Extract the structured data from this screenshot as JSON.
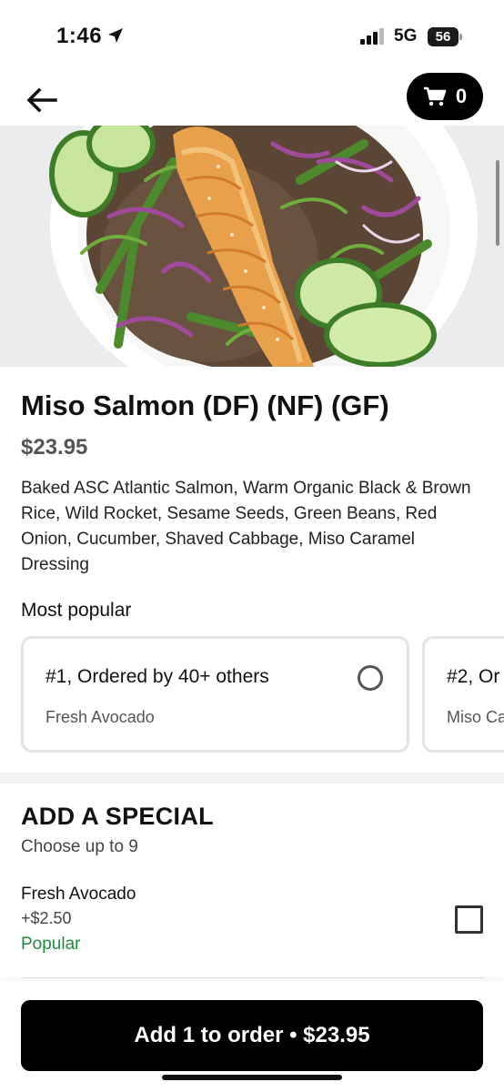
{
  "status_bar": {
    "time": "1:46",
    "network": "5G",
    "battery": "56"
  },
  "header": {
    "cart_count": "0"
  },
  "item": {
    "title": "Miso Salmon (DF) (NF) (GF)",
    "price": "$23.95",
    "description": "Baked ASC Atlantic Salmon, Warm Organic Black & Brown Rice, Wild Rocket, Sesame Seeds, Green Beans, Red Onion, Cucumber, Shaved Cabbage, Miso Caramel Dressing"
  },
  "most_popular": {
    "label": "Most popular",
    "cards": [
      {
        "title": "#1, Ordered by 40+ others",
        "subtitle": "Fresh Avocado"
      },
      {
        "title": "#2, Or",
        "subtitle": "Miso Ca"
      }
    ]
  },
  "special": {
    "title": "ADD A SPECIAL",
    "subtitle": "Choose up to 9",
    "options": [
      {
        "name": "Fresh Avocado",
        "price": "+$2.50",
        "badge": "Popular",
        "checked": false
      }
    ]
  },
  "order_button": {
    "label": "Add 1 to order • $23.95"
  },
  "colors": {
    "accent": "#000000",
    "popular_green": "#1f8a3c"
  }
}
